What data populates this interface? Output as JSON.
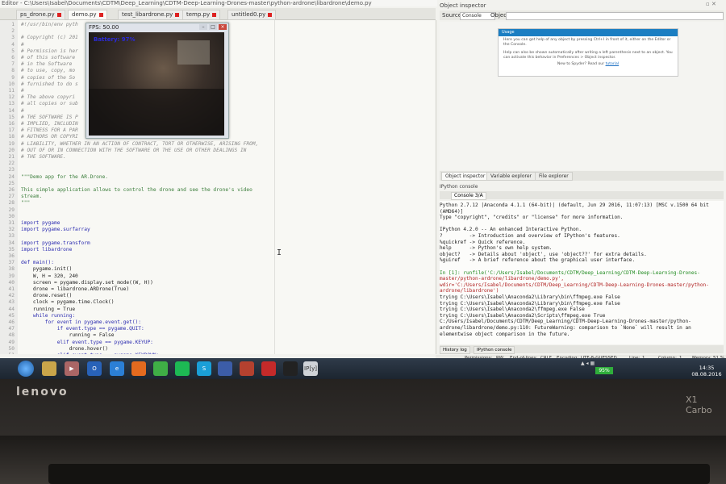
{
  "window": {
    "title": "Editor - C:\\Users\\Isabel\\Documents\\CDTM\\Deep_Learning\\CDTM-Deep-Learning-Drones-master\\python-ardrone\\libardrone\\demo.py"
  },
  "editor_tabs": [
    {
      "label": "ps_drone.py"
    },
    {
      "label": "demo.py"
    },
    {
      "label": "test_libardrone.py"
    },
    {
      "label": "temp.py"
    },
    {
      "label": "untitled0.py"
    }
  ],
  "code_lines": [
    {
      "n": "1",
      "t": "#!/usr/bin/env pyth",
      "k": "cm"
    },
    {
      "n": "2",
      "t": "",
      "k": "cd"
    },
    {
      "n": "3",
      "t": "# Copyright (c) 201",
      "k": "cm"
    },
    {
      "n": "4",
      "t": "#",
      "k": "cm"
    },
    {
      "n": "5",
      "t": "# Permission is her                                  taining a copy",
      "k": "cm"
    },
    {
      "n": "6",
      "t": "# of this software                                   are\"), to deal",
      "k": "cm"
    },
    {
      "n": "7",
      "t": "# in the Software                                    on the rights",
      "k": "cm"
    },
    {
      "n": "8",
      "t": "# to use, copy, mo                                   and/or sell",
      "k": "cm"
    },
    {
      "n": "9",
      "t": "# copies of the So                                   are is",
      "k": "cm"
    },
    {
      "n": "10",
      "t": "# furnished to do s",
      "k": "cm"
    },
    {
      "n": "11",
      "t": "#",
      "k": "cm"
    },
    {
      "n": "12",
      "t": "# The above copyri                                   included in",
      "k": "cm"
    },
    {
      "n": "13",
      "t": "# all copies or sub",
      "k": "cm"
    },
    {
      "n": "14",
      "t": "#",
      "k": "cm"
    },
    {
      "n": "15",
      "t": "# THE SOFTWARE IS P                                   , EXPRESS OR",
      "k": "cm"
    },
    {
      "n": "16",
      "t": "# IMPLIED, INCLUDIN                                   ITABILITY,",
      "k": "cm"
    },
    {
      "n": "17",
      "t": "# FITNESS FOR A PAR                                  NT SHALL THE",
      "k": "cm"
    },
    {
      "n": "18",
      "t": "# AUTHORS OR COPYRI                                   OTHER",
      "k": "cm"
    },
    {
      "n": "19",
      "t": "# LIABILITY, WHETHER IN AN ACTION OF CONTRACT, TORT OR OTHERWISE, ARISING FROM,",
      "k": "cm"
    },
    {
      "n": "20",
      "t": "# OUT OF OR IN CONNECTION WITH THE SOFTWARE OR THE USE OR OTHER DEALINGS IN",
      "k": "cm"
    },
    {
      "n": "21",
      "t": "# THE SOFTWARE.",
      "k": "cm"
    },
    {
      "n": "22",
      "t": "",
      "k": "cd"
    },
    {
      "n": "23",
      "t": "",
      "k": "cd"
    },
    {
      "n": "24",
      "t": "\"\"\"Demo app for the AR.Drone.",
      "k": "st"
    },
    {
      "n": "25",
      "t": "",
      "k": "cd"
    },
    {
      "n": "26",
      "t": "This simple application allows to control the drone and see the drone's video",
      "k": "st"
    },
    {
      "n": "27",
      "t": "stream.",
      "k": "st"
    },
    {
      "n": "28",
      "t": "\"\"\"",
      "k": "st"
    },
    {
      "n": "29",
      "t": "",
      "k": "cd"
    },
    {
      "n": "30",
      "t": "",
      "k": "cd"
    },
    {
      "n": "31",
      "t": "import pygame",
      "k": "kw"
    },
    {
      "n": "32",
      "t": "import pygame.surfarray",
      "k": "kw"
    },
    {
      "n": "33",
      "t": "",
      "k": "cd"
    },
    {
      "n": "34",
      "t": "import pygame.transform",
      "k": "kw"
    },
    {
      "n": "35",
      "t": "import libardrone",
      "k": "kw"
    },
    {
      "n": "36",
      "t": "",
      "k": "cd"
    },
    {
      "n": "37",
      "t": "def main():",
      "k": "kw"
    },
    {
      "n": "38",
      "t": "    pygame.init()",
      "k": "cd"
    },
    {
      "n": "39",
      "t": "    W, H = 320, 240",
      "k": "cd"
    },
    {
      "n": "40",
      "t": "    screen = pygame.display.set_mode((W, H))",
      "k": "cd"
    },
    {
      "n": "41",
      "t": "    drone = libardrone.ARDrone(True)",
      "k": "cd"
    },
    {
      "n": "42",
      "t": "    drone.reset()",
      "k": "cd"
    },
    {
      "n": "43",
      "t": "    clock = pygame.time.Clock()",
      "k": "cd"
    },
    {
      "n": "44",
      "t": "    running = True",
      "k": "cd"
    },
    {
      "n": "45",
      "t": "    while running:",
      "k": "kw"
    },
    {
      "n": "46",
      "t": "        for event in pygame.event.get():",
      "k": "kw"
    },
    {
      "n": "47",
      "t": "            if event.type == pygame.QUIT:",
      "k": "kw"
    },
    {
      "n": "48",
      "t": "                running = False",
      "k": "cd"
    },
    {
      "n": "49",
      "t": "            elif event.type == pygame.KEYUP:",
      "k": "kw"
    },
    {
      "n": "50",
      "t": "                drone.hover()",
      "k": "cd"
    },
    {
      "n": "51",
      "t": "            elif event.type == pygame.KEYDOWN:",
      "k": "kw"
    }
  ],
  "camera_window": {
    "title": "FPS: 50.00",
    "battery": "Battery: 97%"
  },
  "inspector": {
    "title": "Object inspector",
    "source_label": "Source",
    "source_value": "Console",
    "object_label": "Object",
    "usage_title": "Usage",
    "usage_text_1": "Here you can get help of any object by pressing Ctrl+I in front of it, either on the Editor or the Console.",
    "usage_text_2": "Help can also be shown automatically after writing a left parenthesis next to an object. You can activate this behavior in Preferences > Object inspector.",
    "usage_new": "New to Spyder? Read our",
    "usage_link": "tutorial"
  },
  "pane_tabs": [
    {
      "label": "Object inspector"
    },
    {
      "label": "Variable explorer"
    },
    {
      "label": "File explorer"
    }
  ],
  "console": {
    "title": "IPython console",
    "tab_label": "Console 3/A",
    "lines": [
      {
        "t": "Python 2.7.12 |Anaconda 4.1.1 (64-bit)| (default, Jun 29 2016, 11:07:13) [MSC v.1500 64 bit",
        "k": "n"
      },
      {
        "t": "(AMD64)]",
        "k": "n"
      },
      {
        "t": "Type \"copyright\", \"credits\" or \"license\" for more information.",
        "k": "n"
      },
      {
        "t": "",
        "k": "n"
      },
      {
        "t": "IPython 4.2.0 -- An enhanced Interactive Python.",
        "k": "n"
      },
      {
        "t": "?         -> Introduction and overview of IPython's features.",
        "k": "n"
      },
      {
        "t": "%quickref -> Quick reference.",
        "k": "n"
      },
      {
        "t": "help      -> Python's own help system.",
        "k": "n"
      },
      {
        "t": "object?   -> Details about 'object', use 'object??' for extra details.",
        "k": "n"
      },
      {
        "t": "%guiref   -> A brief reference about the graphical user interface.",
        "k": "n"
      },
      {
        "t": "",
        "k": "n"
      },
      {
        "t": "In [1]: runfile('C:/Users/Isabel/Documents/CDTM/Deep_Learning/CDTM-Deep-Learning-Drones-",
        "k": "p"
      },
      {
        "t": "master/python-ardrone/libardrone/demo.py',",
        "k": "r"
      },
      {
        "t": "wdir='C:/Users/Isabel/Documents/CDTM/Deep_Learning/CDTM-Deep-Learning-Drones-master/python-",
        "k": "r"
      },
      {
        "t": "ardrone/libardrone')",
        "k": "r"
      },
      {
        "t": "trying C:\\Users\\Isabel\\Anaconda2\\Library\\bin\\ffmpeg.exe False",
        "k": "n"
      },
      {
        "t": "trying C:\\Users\\Isabel\\Anaconda2\\Library\\bin\\ffmpeg.exe False",
        "k": "n"
      },
      {
        "t": "trying C:\\Users\\Isabel\\Anaconda2\\ffmpeg.exe False",
        "k": "n"
      },
      {
        "t": "trying C:\\Users\\Isabel\\Anaconda2\\Scripts\\ffmpeg.exe True",
        "k": "n"
      },
      {
        "t": "C:/Users/Isabel/Documents/CDTM/Deep_Learning/CDTM-Deep-Learning-Drones-master/python-",
        "k": "n"
      },
      {
        "t": "ardrone/libardrone/demo.py:110: FutureWarning: comparison to `None` will result in an",
        "k": "n"
      },
      {
        "t": "elementwise object comparison in the future.",
        "k": "n"
      }
    ],
    "bottom_tabs": [
      {
        "label": "History log"
      },
      {
        "label": "IPython console"
      }
    ]
  },
  "statusbar": {
    "permissions_label": "Permissions:",
    "permissions": "RW",
    "eol_label": "End-of-lines:",
    "eol": "CRLF",
    "encoding_label": "Encoding:",
    "encoding": "UTF-8-GUESSED",
    "line_label": "Line:",
    "line": "1",
    "column_label": "Column:",
    "column": "1",
    "memory_label": "Memory:",
    "memory": "51 %"
  },
  "taskbar": {
    "battery": "95%",
    "time": "14:35",
    "date": "08.08.2016",
    "ipython_label": "IP[y]"
  },
  "laptop": {
    "brand": "lenovo",
    "model": "X1 Carbo"
  }
}
